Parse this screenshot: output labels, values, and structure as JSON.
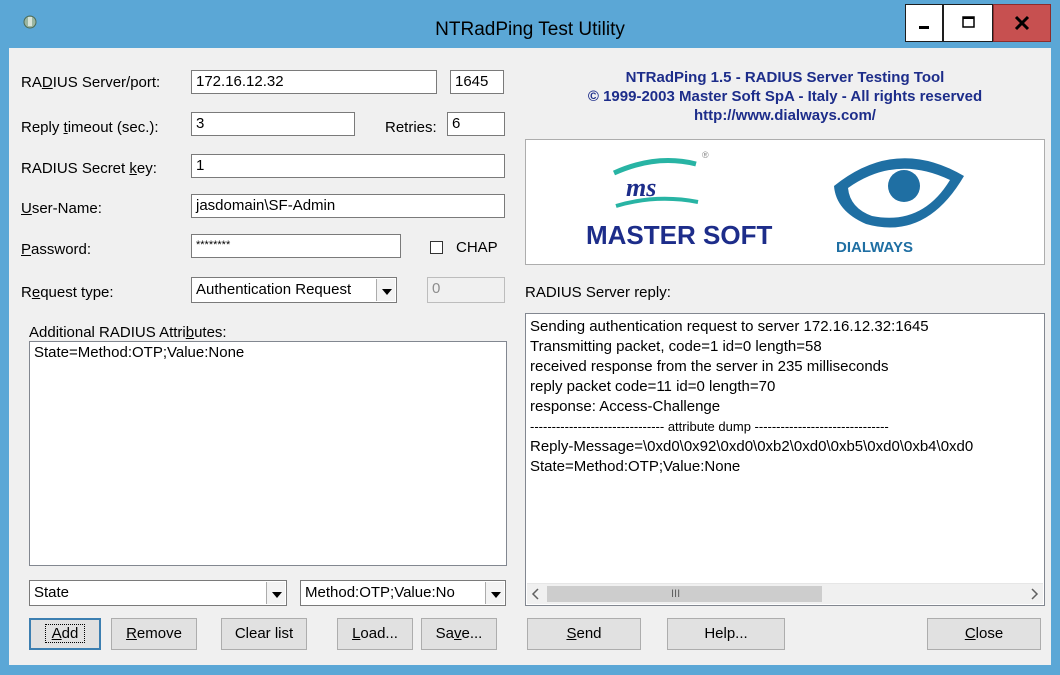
{
  "window": {
    "title": "NTRadPing Test Utility"
  },
  "form": {
    "server_label_a": "RA",
    "server_label_u": "D",
    "server_label_b": "IUS Server/port:",
    "server_value": "172.16.12.32",
    "port_value": "1645",
    "timeout_label_a": "Reply ",
    "timeout_label_u": "t",
    "timeout_label_b": "imeout (sec.):",
    "timeout_value": "3",
    "retries_label": "Retries:",
    "retries_value": "6",
    "secret_label_a": "RADIUS Secret ",
    "secret_label_u": "k",
    "secret_label_b": "ey:",
    "secret_value": "1",
    "username_label_u": "U",
    "username_label_b": "ser-Name:",
    "username_value": "jasdomain\\SF-Admin",
    "password_label_u": "P",
    "password_label_b": "assword:",
    "password_value": "********",
    "chap_label": "CHAP",
    "request_label_a": "R",
    "request_label_u": "e",
    "request_label_b": "quest type:",
    "request_value": "Authentication Request",
    "request_extra_value": "0"
  },
  "attributes": {
    "label_a": "Additional RADIUS Attri",
    "label_u": "b",
    "label_b": "utes:",
    "items": [
      "State=Method:OTP;Value:None"
    ],
    "attr_name_value": "State",
    "attr_value_value": "Method:OTP;Value:No"
  },
  "buttons": {
    "add_u": "A",
    "add_b": "dd",
    "remove_u": "R",
    "remove_b": "emove",
    "clear": "Clear list",
    "load_u": "L",
    "load_b": "oad...",
    "save_a": "Sa",
    "save_u": "v",
    "save_b": "e...",
    "send_u": "S",
    "send_b": "end",
    "help": "Help...",
    "close_u": "C",
    "close_b": "lose"
  },
  "header": {
    "line1": "NTRadPing 1.5 - RADIUS Server Testing Tool",
    "line2": "© 1999-2003 Master Soft SpA - Italy - All rights reserved",
    "line3": "http://www.dialways.com/"
  },
  "logos": {
    "mastersoft_ms": "ms",
    "mastersoft_master": "MASTER",
    "mastersoft_soft": "SOFT",
    "mastersoft_mark": "®",
    "dialways": "DIALWAYS"
  },
  "reply": {
    "label": "RADIUS Server reply:",
    "lines": [
      "Sending authentication request to server 172.16.12.32:1645",
      "Transmitting packet, code=1 id=0 length=58",
      "received response from the server in 235 milliseconds",
      "reply packet code=11 id=0 length=70",
      "response: Access-Challenge",
      "------------------------------- attribute dump -------------------------------",
      "Reply-Message=\\0xd0\\0x92\\0xd0\\0xb2\\0xd0\\0xb5\\0xd0\\0xb4\\0xd0",
      "State=Method:OTP;Value:None"
    ],
    "scroll_thumb_glyph": "III"
  },
  "colors": {
    "titlebar": "#5ba7d6",
    "header_text": "#1d2d8a",
    "close_button": "#c75050"
  }
}
